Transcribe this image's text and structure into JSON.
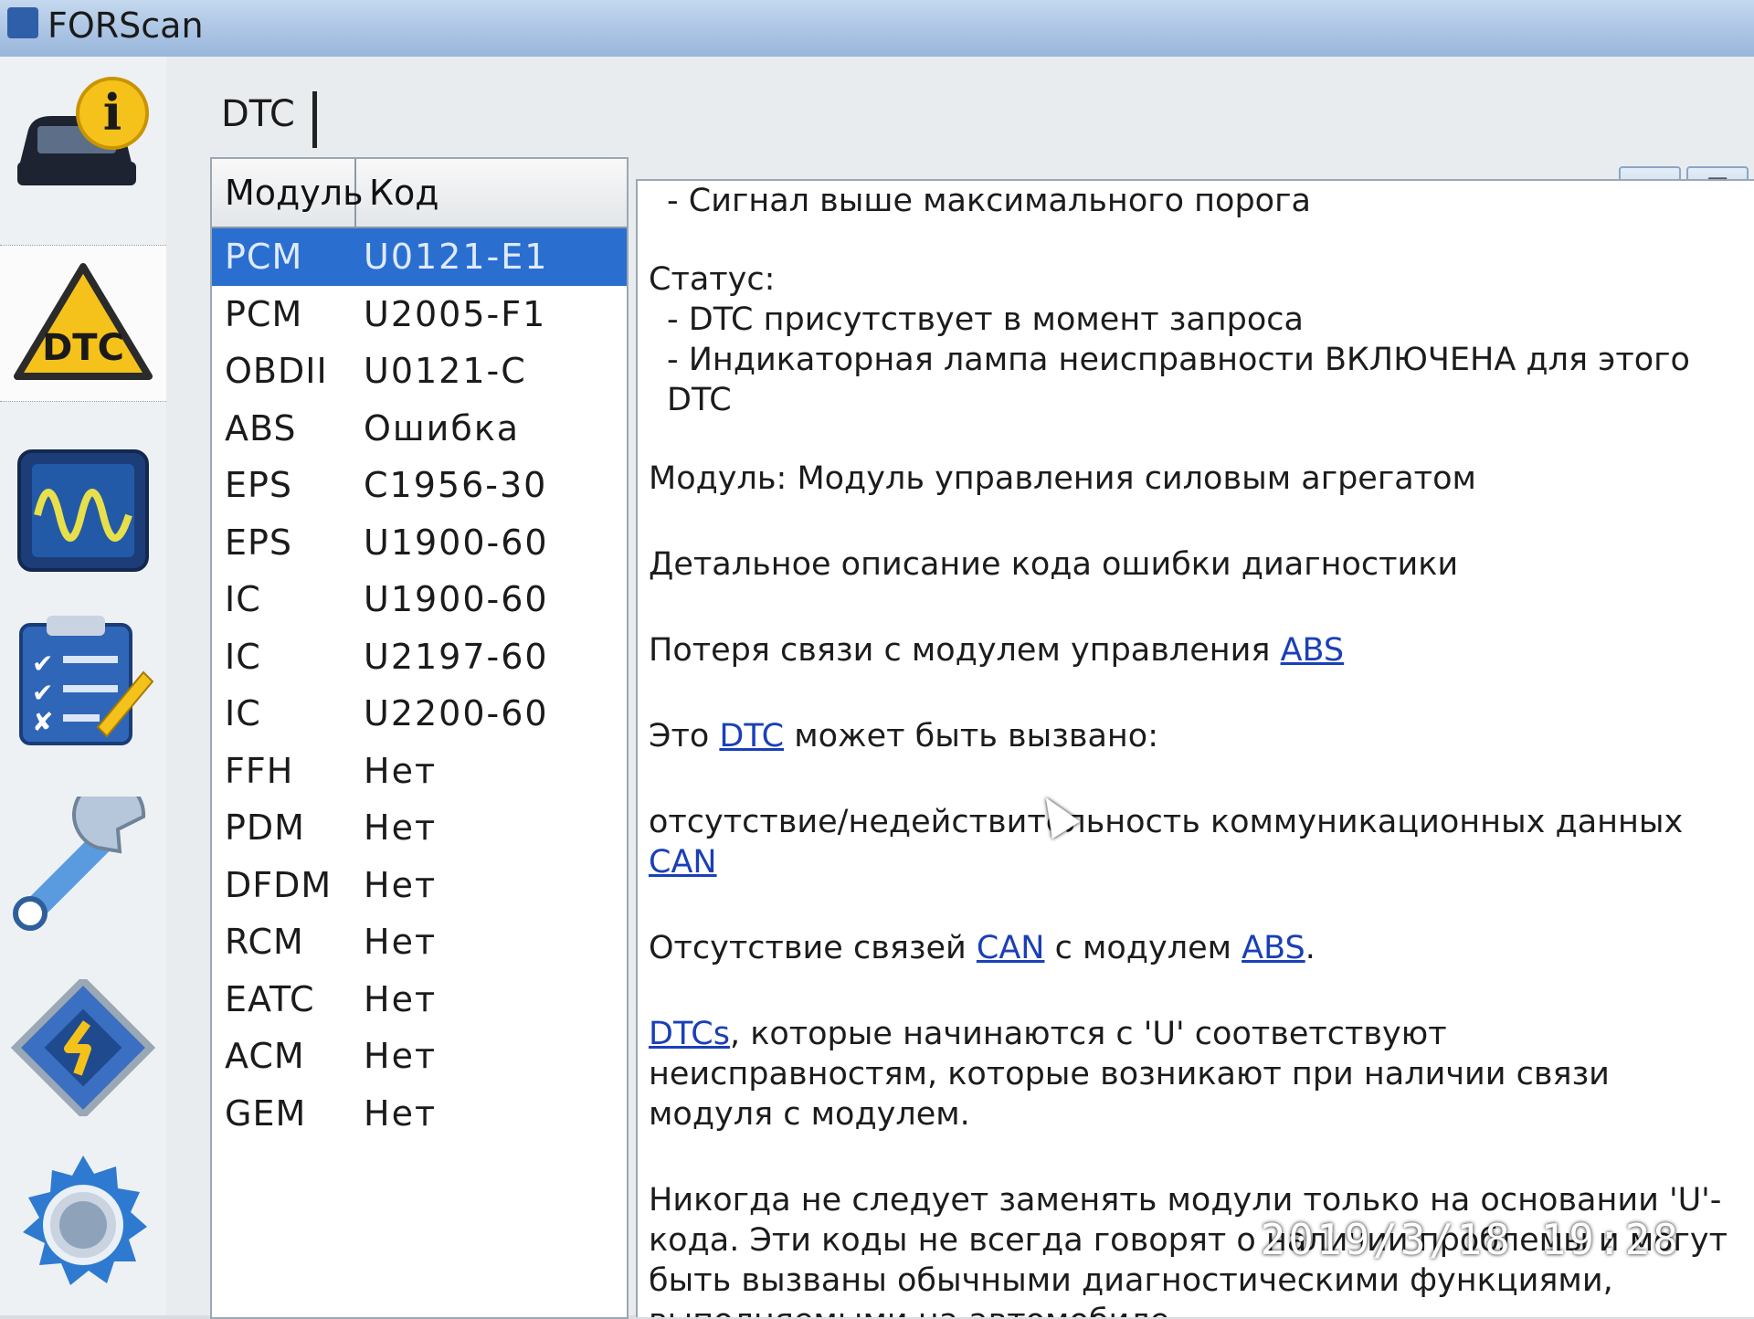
{
  "window": {
    "title": "FORScan",
    "minimize": "–",
    "maximize": "□"
  },
  "sidebar": {
    "items": [
      {
        "name": "vehicle-info"
      },
      {
        "name": "dtc",
        "icon_label": "DTC",
        "active": true
      },
      {
        "name": "oscilloscope"
      },
      {
        "name": "tests"
      },
      {
        "name": "service"
      },
      {
        "name": "configuration"
      },
      {
        "name": "settings"
      }
    ]
  },
  "panel": {
    "title": "DTC"
  },
  "dtc_table": {
    "headers": [
      "Модуль",
      "Код"
    ],
    "rows": [
      {
        "module": "PCM",
        "code": "U0121-E1",
        "selected": true
      },
      {
        "module": "PCM",
        "code": "U2005-F1"
      },
      {
        "module": "OBDII",
        "code": "U0121-C"
      },
      {
        "module": "ABS",
        "code": "Ошибка"
      },
      {
        "module": "EPS",
        "code": "C1956-30"
      },
      {
        "module": "EPS",
        "code": "U1900-60"
      },
      {
        "module": "IC",
        "code": "U1900-60"
      },
      {
        "module": "IC",
        "code": "U2197-60"
      },
      {
        "module": "IC",
        "code": "U2200-60"
      },
      {
        "module": "FFH",
        "code": "Нет"
      },
      {
        "module": "PDM",
        "code": "Нет"
      },
      {
        "module": "DFDM",
        "code": "Нет"
      },
      {
        "module": "RCM",
        "code": "Нет"
      },
      {
        "module": "EATC",
        "code": "Нет"
      },
      {
        "module": "ACM",
        "code": "Нет"
      },
      {
        "module": "GEM",
        "code": "Нет"
      }
    ]
  },
  "description": {
    "line_top": " - Сигнал выше максимального порога",
    "status_label": "Статус:",
    "status_1": " - DTC присутствует в момент запроса",
    "status_2": " - Индикаторная лампа неисправности ВКЛЮЧЕНА для этого DTC",
    "module_line": "Модуль: Модуль управления силовым агрегатом",
    "detail_heading": "Детальное описание кода ошибки диагностики",
    "loss_text": "Потеря связи с модулем управления ",
    "loss_link": "ABS",
    "cause_pre": "Это ",
    "cause_link": "DTC",
    "cause_post": " может быть вызвано:",
    "can_text": "отсутствие/недействительность коммуникационных данных ",
    "can_link": "CAN",
    "abs_pre": "Отсутствие связей ",
    "abs_link1": "CAN",
    "abs_mid": " с модулем ",
    "abs_link2": "ABS",
    "abs_post": ".",
    "u_link": "DTCs",
    "u_text": ", которые начинаются с 'U' соответствуют неисправностям, которые возникают при наличии связи модуля с модулем.",
    "never_text": "Никогда не следует заменять модули только на основании 'U'-кода. Эти коды не всегда говорят о наличии проблемы и могут быть вызваны обычными диагностическими функциями, выполняемыми на автомобиле."
  },
  "photo_timestamp": "2019/3/18  19:28",
  "colors": {
    "selection": "#2a6fd0",
    "link": "#1a3fb8"
  }
}
